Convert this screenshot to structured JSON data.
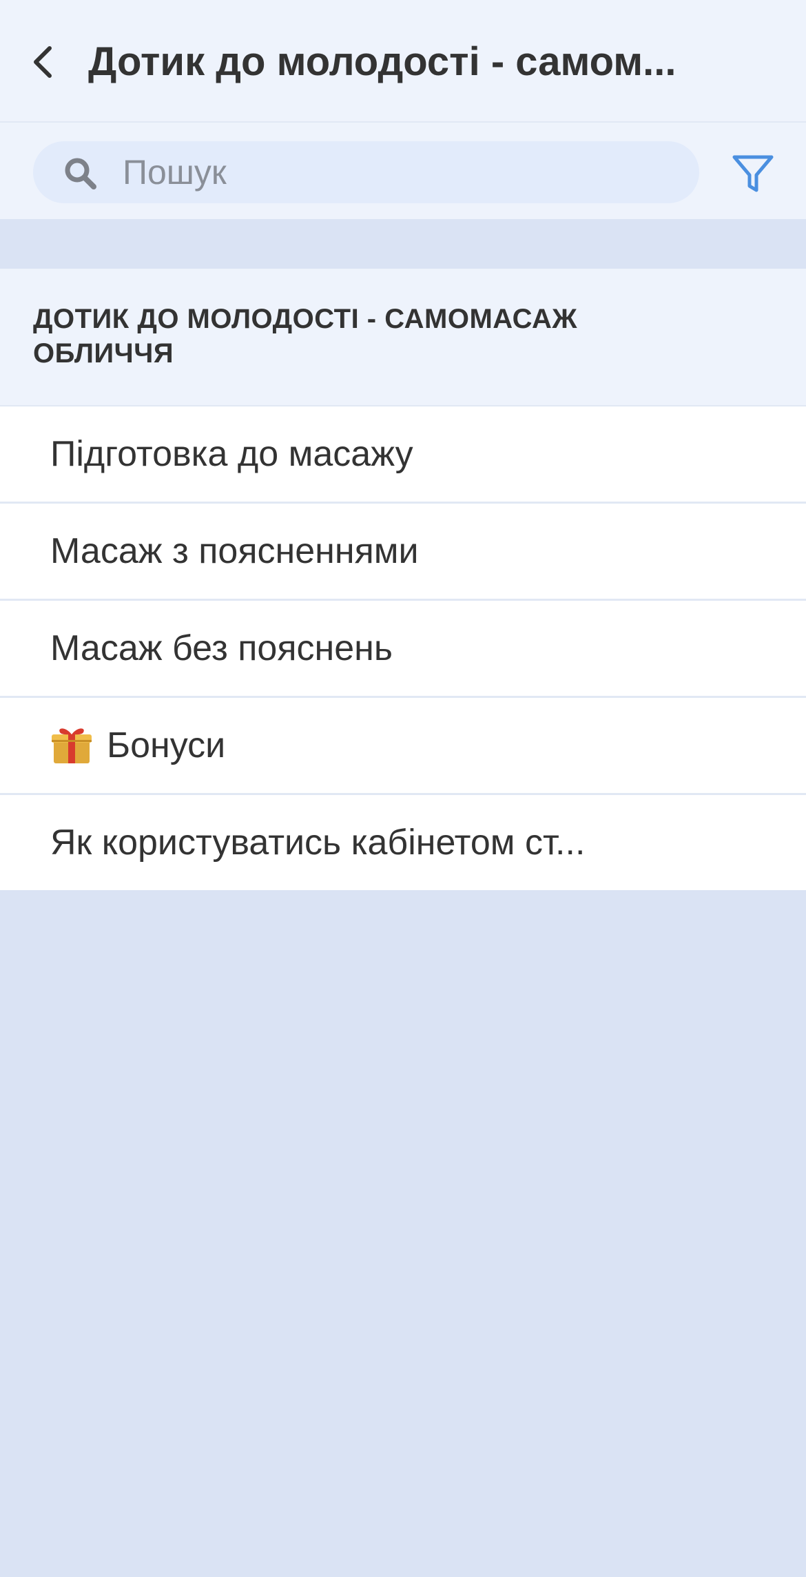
{
  "header": {
    "title": "Дотик до молодості - самом..."
  },
  "search": {
    "placeholder": "Пошук",
    "value": ""
  },
  "section": {
    "title": "ДОТИК ДО МОЛОДОСТІ - САМОМАСАЖ ОБЛИЧЧЯ"
  },
  "lessons": [
    {
      "label": "Підготовка до масажу"
    },
    {
      "label": "Масаж з поясненнями"
    },
    {
      "label": "Масаж без пояснень"
    },
    {
      "label": "Бонуси",
      "icon": "gift-icon"
    },
    {
      "label": "Як користуватись кабінетом ст..."
    }
  ],
  "colors": {
    "header_bg": "#eef3fc",
    "search_field_bg": "#e2ebfb",
    "page_bg": "#dae3f4",
    "accent": "#4a8fe0",
    "text": "#333333"
  }
}
